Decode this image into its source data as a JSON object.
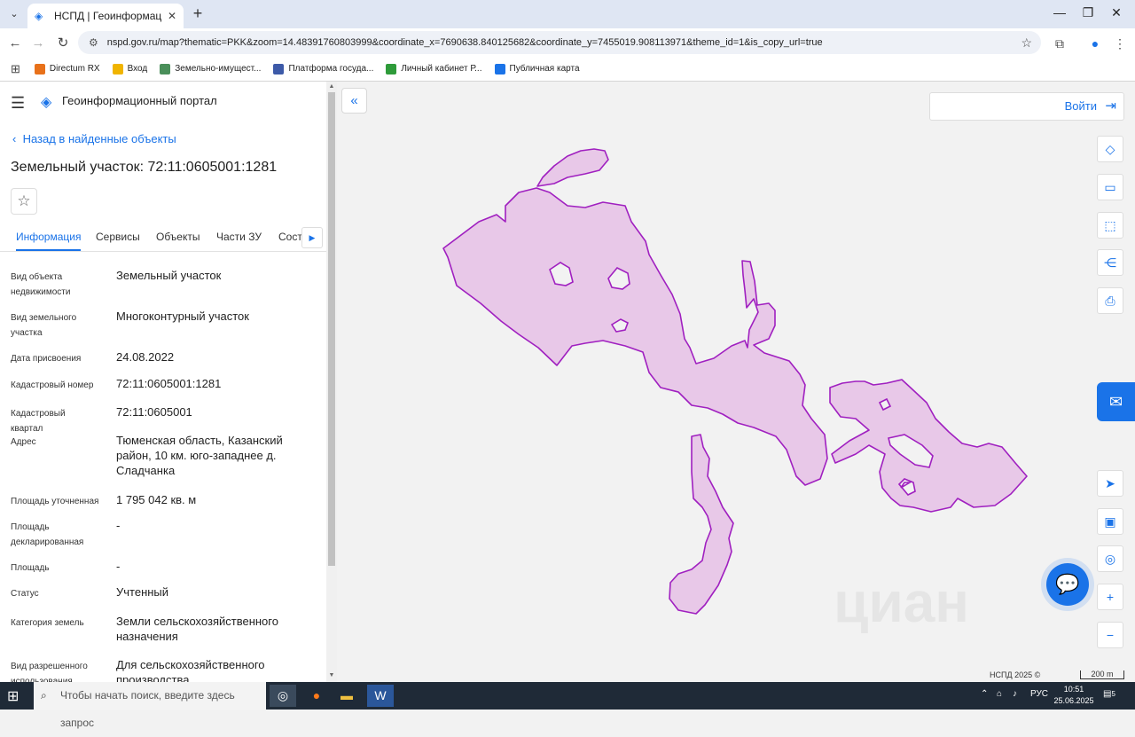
{
  "browser": {
    "tab_title": "НСПД | Геоинформационный",
    "url": "nspd.gov.ru/map?thematic=PKK&zoom=14.48391760803999&coordinate_x=7690638.840125682&coordinate_y=7455019.908113971&theme_id=1&is_copy_url=true",
    "bookmarks": [
      {
        "label": "Directum RX",
        "color": "#e8711a"
      },
      {
        "label": "Вход",
        "color": "#f0b400"
      },
      {
        "label": "Земельно-имущест...",
        "color": "#4a8f5a"
      },
      {
        "label": "Платформа госуда...",
        "color": "#3d5aa8"
      },
      {
        "label": "Личный кабинет Р...",
        "color": "#2e9b3a"
      },
      {
        "label": "Публичная карта",
        "color": "#1a73e8"
      }
    ]
  },
  "panel": {
    "portal_title": "Геоинформационный портал",
    "back_link": "Назад в найденные объекты",
    "heading": "Земельный участок: 72:11:0605001:1281",
    "tabs": [
      "Информация",
      "Сервисы",
      "Объекты",
      "Части ЗУ",
      "Состав"
    ],
    "rows": [
      {
        "label": "Вид объекта недвижимости",
        "value": "Земельный участок"
      },
      {
        "label": "Вид земельного участка",
        "value": "Многоконтурный участок"
      },
      {
        "label": "Дата присвоения",
        "value": "24.08.2022"
      },
      {
        "label": "Кадастровый номер",
        "value": "72:11:0605001:1281"
      },
      {
        "label": "Кадастровый квартал",
        "value": "72:11:0605001"
      },
      {
        "label": "Адрес",
        "value": "Тюменская область, Казанский район, 10 км. юго-западнее д. Сладчанка"
      },
      {
        "label": "Площадь уточненная",
        "value": "1 795 042 кв. м"
      },
      {
        "label": "Площадь декларированная",
        "value": "-"
      },
      {
        "label": "Площадь",
        "value": "-"
      },
      {
        "label": "Статус",
        "value": "Учтенный"
      },
      {
        "label": "Категория земель",
        "value": "Земли сельскохозяйственного назначения"
      },
      {
        "label": "Вид разрешенного использования",
        "value": "Для сельскохозяйственного производства"
      }
    ]
  },
  "map": {
    "login_label": "Войти",
    "copyright": "НСПД 2025 ©",
    "scale_label": "200 m",
    "watermark": "циан",
    "parcel_fill": "#e8c8e8",
    "parcel_stroke": "#a020c0",
    "accent": "#1a73e8"
  },
  "taskbar": {
    "search_placeholder": "Чтобы начать поиск, введите здесь запрос",
    "language": "РУС",
    "time": "10:51",
    "date": "25.06.2025",
    "notifications": "5"
  }
}
